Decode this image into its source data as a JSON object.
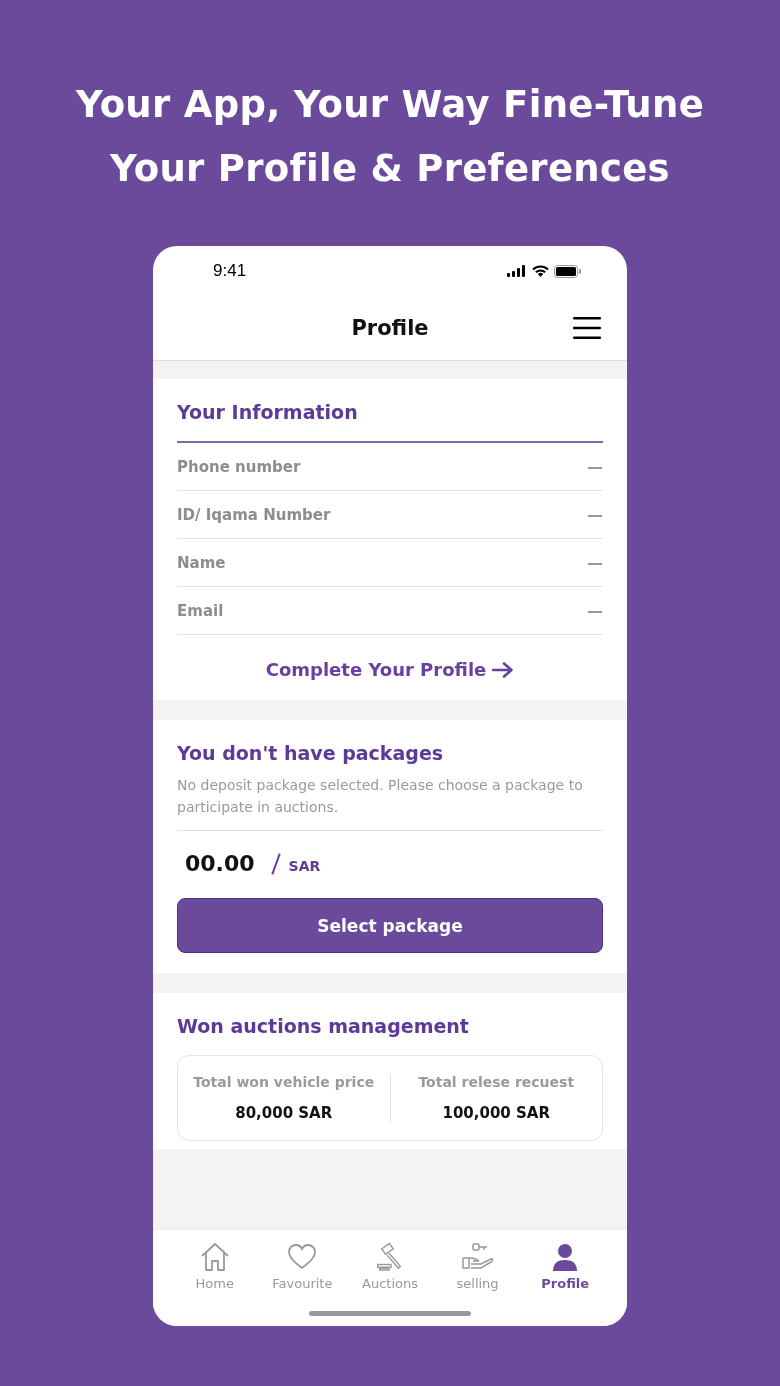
{
  "headline": [
    "Your App, Your Way Fine-Tune",
    "Your Profile & Preferences"
  ],
  "status_bar": {
    "time": "9:41"
  },
  "header": {
    "title": "Profile"
  },
  "information": {
    "title": "Your Information",
    "fields": [
      {
        "label": "Phone number",
        "value": "—"
      },
      {
        "label": "ID/ Iqama Number",
        "value": "—"
      },
      {
        "label": "Name",
        "value": "—"
      },
      {
        "label": "Email",
        "value": "—"
      }
    ],
    "link": "Complete Your Profile"
  },
  "packages": {
    "title": "You don't have packages",
    "description": "No deposit package selected. Please choose a package to participate in auctions.",
    "amount": "00.00",
    "currency": "SAR",
    "button": "Select package"
  },
  "won_auctions": {
    "title": "Won auctions management",
    "stats": [
      {
        "label": "Total won vehicle price",
        "value": "80,000 SAR"
      },
      {
        "label": "Total relese recuest",
        "value": "100,000 SAR"
      }
    ]
  },
  "tab_bar": [
    {
      "kind": "home",
      "label": "Home",
      "selected": false
    },
    {
      "kind": "heart",
      "label": "Favourite",
      "selected": false
    },
    {
      "kind": "gavel",
      "label": "Auctions",
      "selected": false
    },
    {
      "kind": "selling",
      "label": "selling",
      "selected": false
    },
    {
      "kind": "person",
      "label": "Profile",
      "selected": true
    }
  ]
}
